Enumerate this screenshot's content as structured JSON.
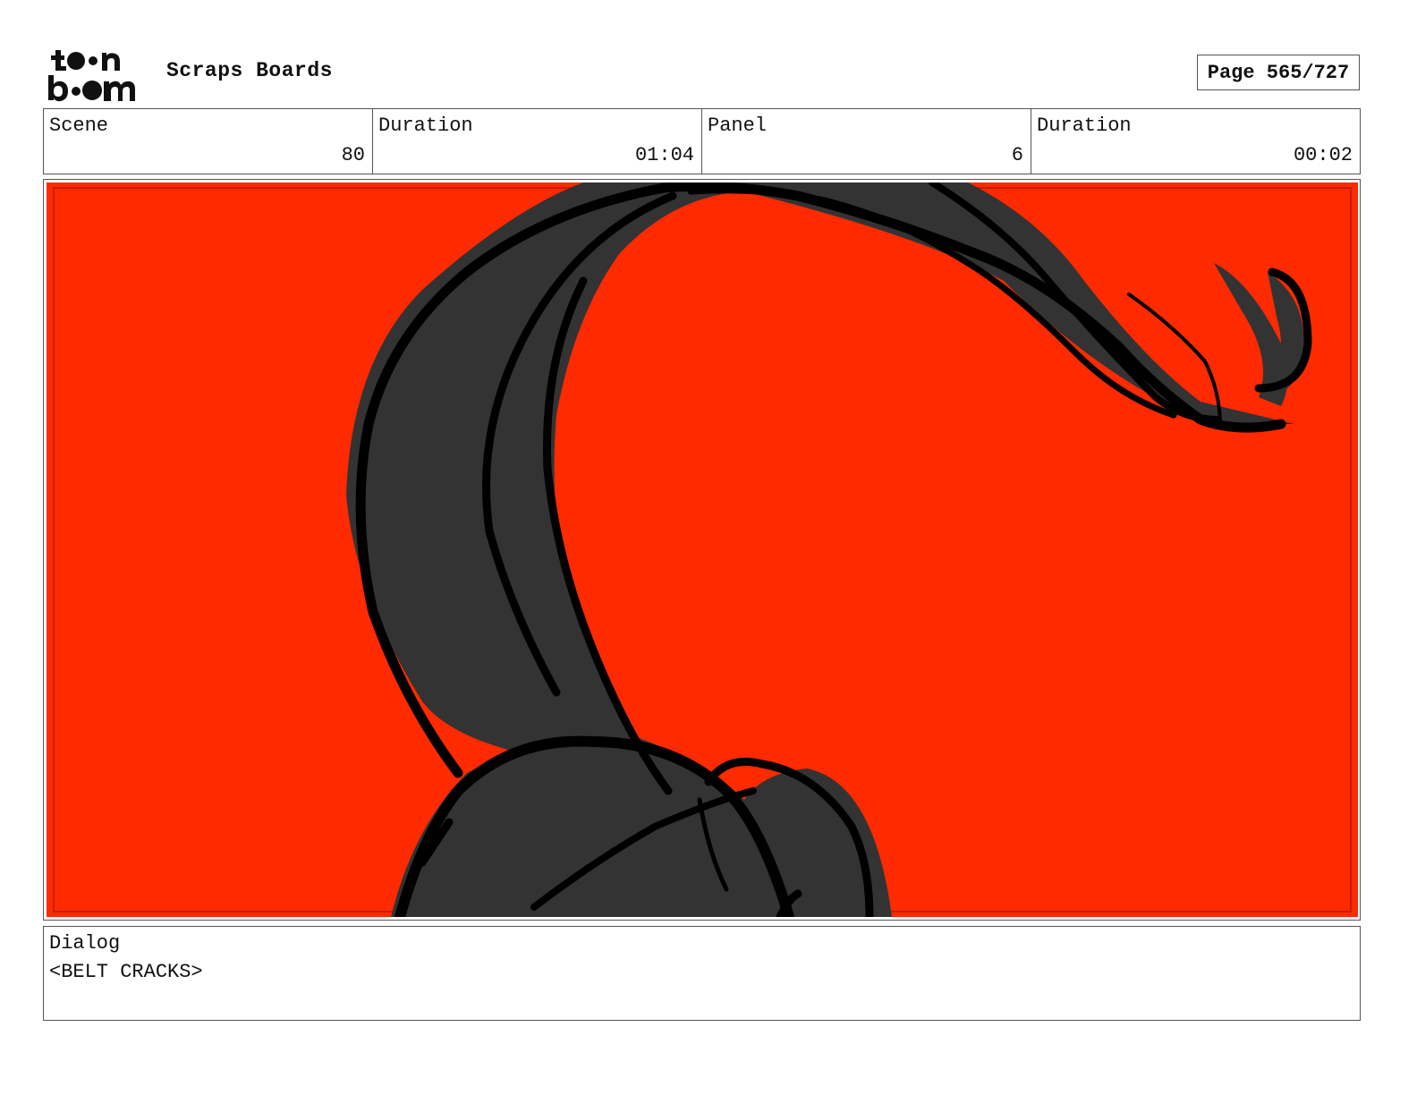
{
  "header": {
    "logo_icon": "toonboom-logo",
    "logo_text": "toon boom",
    "title": "Scraps Boards",
    "page": "Page 565/727"
  },
  "info": {
    "scene_label": "Scene",
    "scene_value": "80",
    "scene_duration_label": "Duration",
    "scene_duration_value": "01:04",
    "panel_label": "Panel",
    "panel_value": "6",
    "panel_duration_label": "Duration",
    "panel_duration_value": "00:02"
  },
  "panel_image": {
    "background_color": "#ff2a00",
    "fill_color": "#333333",
    "line_color": "#000000"
  },
  "dialog": {
    "label": "Dialog",
    "text": "<BELT CRACKS>"
  }
}
